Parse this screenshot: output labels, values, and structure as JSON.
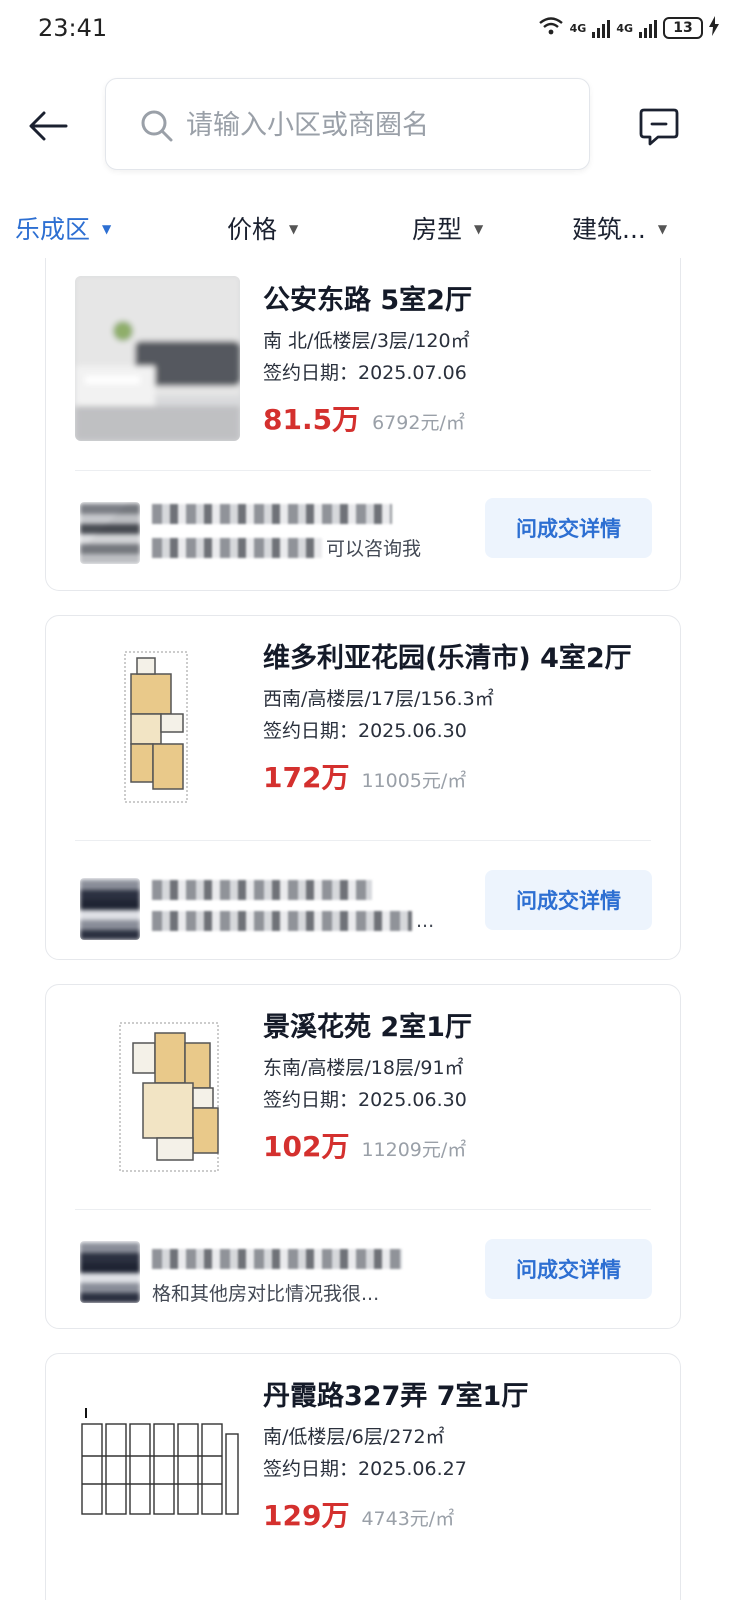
{
  "status_bar": {
    "time": "23:41",
    "network": "4G",
    "battery": "13",
    "wifi_badge": "6"
  },
  "search": {
    "placeholder": "请输入小区或商圈名",
    "value": ""
  },
  "filters": [
    {
      "label": "乐成区",
      "active": true
    },
    {
      "label": "价格",
      "active": false
    },
    {
      "label": "房型",
      "active": false
    },
    {
      "label": "建筑...",
      "active": false
    }
  ],
  "listings": [
    {
      "title": "公安东路 5室2厅",
      "meta": "南 北/低楼层/3层/120㎡",
      "sign_date": "签约日期：2025.07.06",
      "price": "81.5万",
      "unit_price": "6792元/㎡",
      "agent_quote": "可以咨询我",
      "button": "问成交详情"
    },
    {
      "title": "维多利亚花园(乐清市) 4室2厅",
      "meta": "西南/高楼层/17层/156.3㎡",
      "sign_date": "签约日期：2025.06.30",
      "price": "172万",
      "unit_price": "11005元/㎡",
      "agent_quote": "...",
      "button": "问成交详情"
    },
    {
      "title": "景溪花苑 2室1厅",
      "meta": "东南/高楼层/18层/91㎡",
      "sign_date": "签约日期：2025.06.30",
      "price": "102万",
      "unit_price": "11209元/㎡",
      "agent_quote": "格和其他房对比情况我很...",
      "button": "问成交详情"
    },
    {
      "title": "丹霞路327弄 7室1厅",
      "meta": "南/低楼层/6层/272㎡",
      "sign_date": "签约日期：2025.06.27",
      "price": "129万",
      "unit_price": "4743元/㎡"
    }
  ],
  "colors": {
    "accent": "#2d6fd2",
    "price": "#d4302e",
    "button_bg": "#edf4fd"
  }
}
